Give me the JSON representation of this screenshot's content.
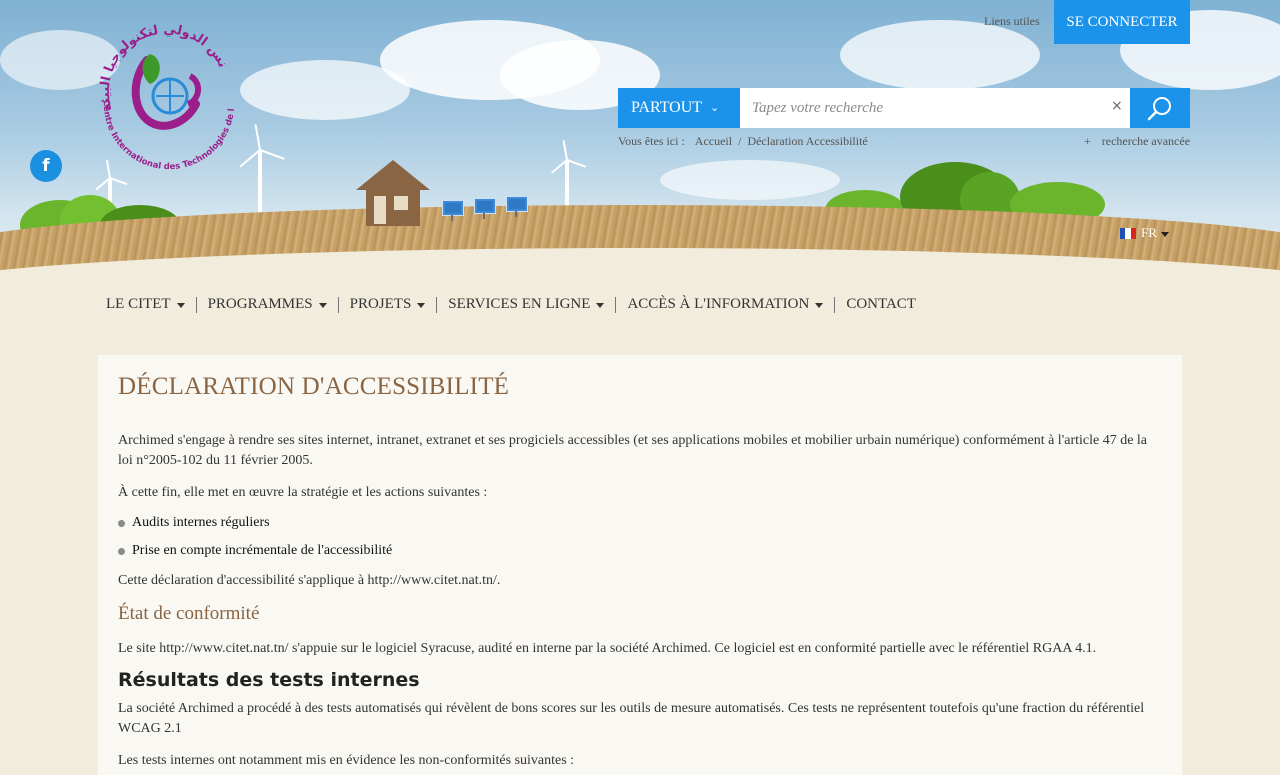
{
  "header": {
    "logo_alt": "Centre International des Technologies de l'Environnement de Tunis",
    "logo_text_fr": "Centre International des Technologies de l'Environnement de Tunis",
    "logo_text_ar": "مركز تونس الدولي لتكنولوجيا البيئة",
    "liens_utiles": "Liens utiles",
    "connect_label": "SE CONNECTER",
    "search": {
      "scope_label": "PARTOUT",
      "placeholder": "Tapez votre recherche",
      "clear_symbol": "×",
      "advanced_plus": "+",
      "advanced_label": "recherche avancée"
    },
    "breadcrumb": {
      "prefix": "Vous êtes ici :",
      "home": "Accueil",
      "separator": "/",
      "current": "Déclaration Accessibilité"
    },
    "language": "FR",
    "social_facebook": "f",
    "colors": {
      "accent": "#1b93ea",
      "title": "#8a6544"
    }
  },
  "nav": {
    "items": [
      {
        "label": "LE CITET",
        "has_menu": true
      },
      {
        "label": "PROGRAMMES",
        "has_menu": true
      },
      {
        "label": "PROJETS",
        "has_menu": true
      },
      {
        "label": "SERVICES EN LIGNE",
        "has_menu": true
      },
      {
        "label": "ACCÈS À L'INFORMATION",
        "has_menu": true
      },
      {
        "label": "CONTACT",
        "has_menu": false
      }
    ]
  },
  "content": {
    "title": "DÉCLARATION D'ACCESSIBILITÉ",
    "intro": "Archimed s'engage à rendre ses sites internet, intranet, extranet et ses progiciels accessibles (et ses applications mobiles et mobilier urbain numérique) conformément à l'article 47 de la loi n°2005-102 du 11 février 2005.",
    "strategy": "À cette fin, elle met en œuvre la stratégie et les actions suivantes :",
    "bullets": [
      "Audits internes réguliers",
      "Prise en compte incrémentale de l'accessibilité"
    ],
    "applies": "Cette déclaration d'accessibilité s'applique à http://www.citet.nat.tn/.",
    "conformity_title": "État de conformité",
    "conformity_text": "Le site http://www.citet.nat.tn/ s'appuie sur le logiciel Syracuse, audité en interne par la société Archimed. Ce logiciel est en conformité partielle avec le référentiel RGAA 4.1.",
    "results_title": "Résultats des tests internes",
    "results_text": "La société Archimed a procédé à des tests automatisés qui révèlent de bons scores sur les outils de mesure automatisés. Ces tests ne représentent toutefois qu'une fraction du référentiel WCAG 2.1",
    "results_more": "Les tests internes ont notamment mis en évidence les non-conformités suivantes :"
  }
}
